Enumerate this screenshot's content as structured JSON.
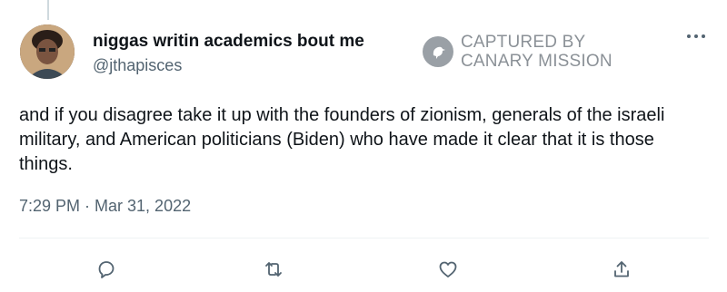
{
  "tweet": {
    "display_name": "niggas writin academics bout me",
    "handle": "@jthapisces",
    "text": "and if you disagree take it up with the founders of zionism, generals of the israeli military, and American politicians (Biden) who have made it clear that it is those things.",
    "timestamp": "7:29 PM · Mar 31, 2022",
    "more_icon": "more-horizontal-icon"
  },
  "watermark": {
    "line1": "CAPTURED BY",
    "line2": "CANARY MISSION",
    "logo_icon": "canary-bird-logo"
  },
  "actions": [
    {
      "name": "reply",
      "icon": "reply-icon"
    },
    {
      "name": "retweet",
      "icon": "retweet-icon"
    },
    {
      "name": "like",
      "icon": "heart-icon"
    },
    {
      "name": "share",
      "icon": "share-icon"
    }
  ],
  "colors": {
    "text_primary": "#0f1419",
    "text_secondary": "#536471",
    "watermark": "#8b9197",
    "divider": "#eff3f4"
  }
}
